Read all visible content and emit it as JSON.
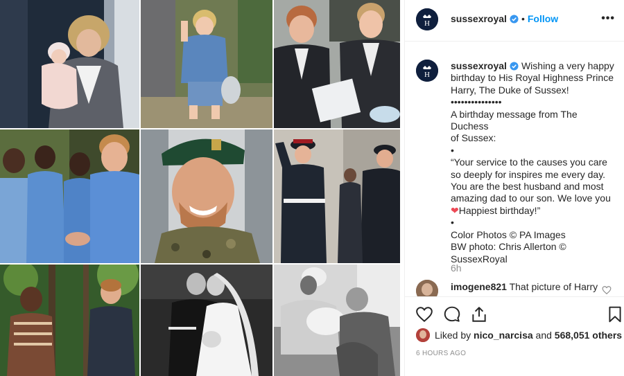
{
  "post": {
    "account": "sussexroyal",
    "follow_label": "Follow",
    "more_label": "•••",
    "caption_lines": [
      "Wishing a very happy",
      "birthday to His Royal Highness Prince",
      "Harry, The Duke of Sussex!",
      "•••••••••••••••",
      "A birthday message from The Duchess",
      "of Sussex:",
      "•",
      "“Your service to the causes you care",
      "so deeply for inspires me every day.",
      "You are the best husband and most",
      "amazing dad to our son. We love you",
      "Happiest birthday!”",
      "•",
      "Color Photos © PA Images",
      "BW photo: Chris Allerton ©",
      "SussexRoyal"
    ],
    "age": "6h",
    "comment": {
      "user": "imogene821",
      "text": "That picture of Harry"
    },
    "likes": {
      "prefix": "Liked by",
      "user": "nico_narcisa",
      "joiner": "and",
      "count": "568,051 others"
    },
    "timestamp": "6 HOURS AGO"
  },
  "icons": {
    "verified": "verified-badge-icon",
    "like": "heart-icon",
    "comment": "comment-bubble-icon",
    "share": "share-icon",
    "save": "bookmark-icon",
    "more": "more-options-icon"
  },
  "colors": {
    "link_blue": "#0095f6",
    "verified_blue": "#3897f0",
    "heart_red": "#ed4956",
    "muted_text": "#8e8e8e",
    "avatar_navy": "#0f1f3d"
  }
}
